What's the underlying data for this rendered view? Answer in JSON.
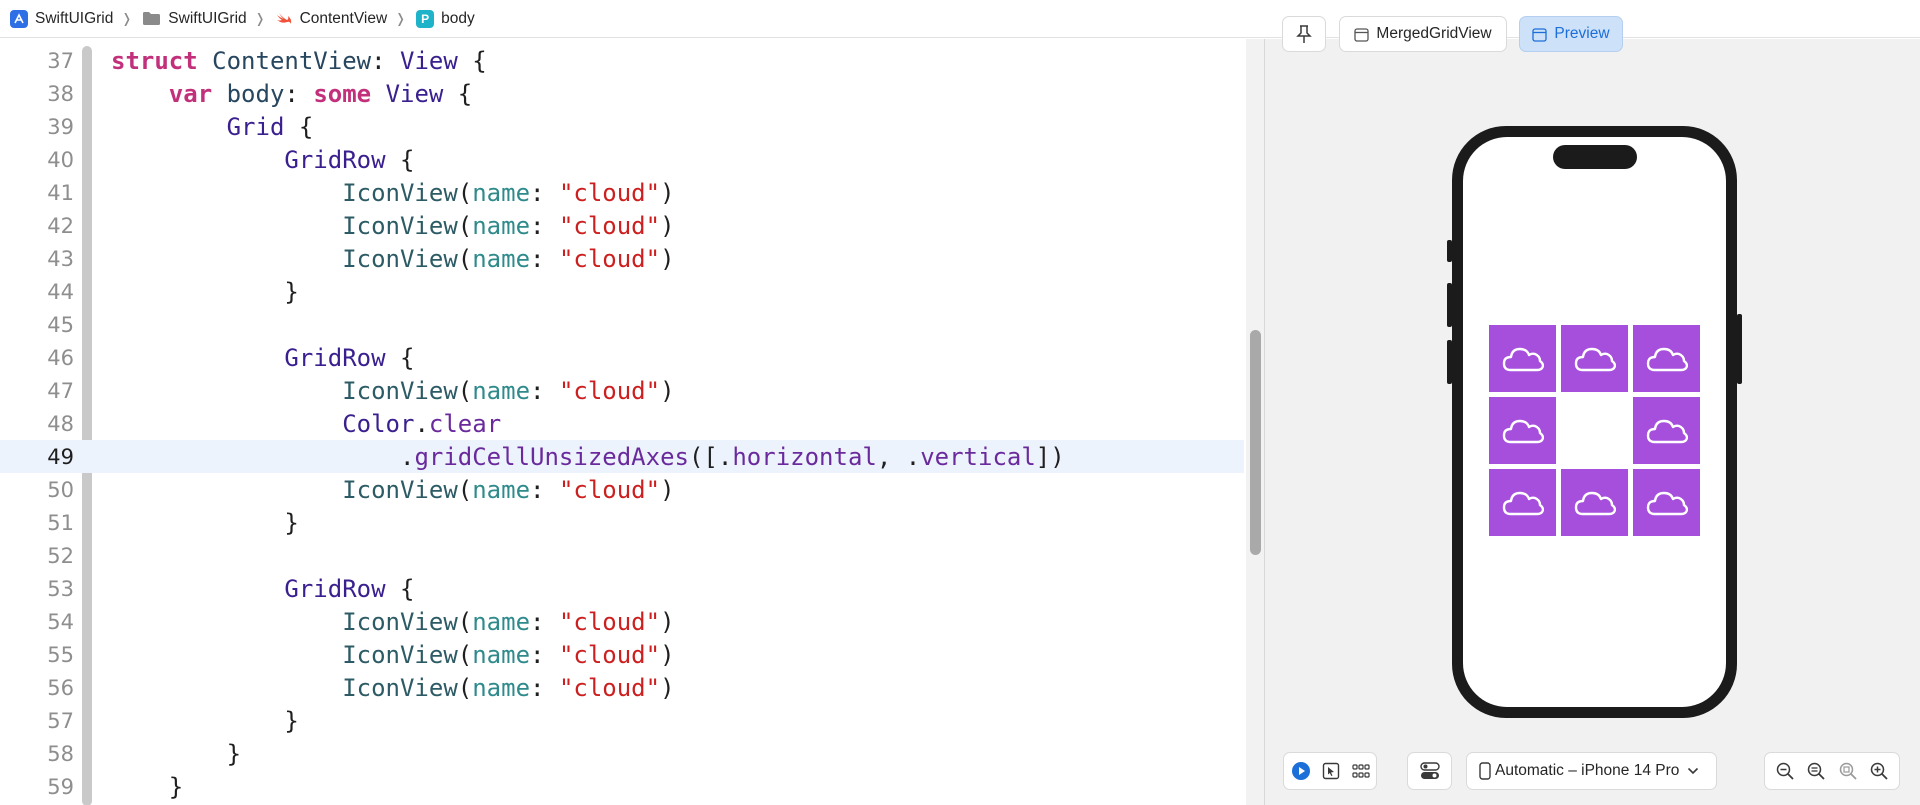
{
  "breadcrumb": {
    "project": "SwiftUIGrid",
    "group": "SwiftUIGrid",
    "file": "ContentView",
    "symbol": "body",
    "symbol_badge": "P"
  },
  "editor": {
    "current_line": "49",
    "lines": [
      {
        "n": "37"
      },
      {
        "n": "38"
      },
      {
        "n": "39"
      },
      {
        "n": "40"
      },
      {
        "n": "41"
      },
      {
        "n": "42"
      },
      {
        "n": "43"
      },
      {
        "n": "44"
      },
      {
        "n": "45"
      },
      {
        "n": "46"
      },
      {
        "n": "47"
      },
      {
        "n": "48"
      },
      {
        "n": "49"
      },
      {
        "n": "50"
      },
      {
        "n": "51"
      },
      {
        "n": "52"
      },
      {
        "n": "53"
      },
      {
        "n": "54"
      },
      {
        "n": "55"
      },
      {
        "n": "56"
      },
      {
        "n": "57"
      },
      {
        "n": "58"
      },
      {
        "n": "59"
      }
    ],
    "code": {
      "l37": [
        "struct",
        " ",
        "ContentView",
        ": ",
        "View",
        " {"
      ],
      "l38": [
        "var",
        " ",
        "body",
        ": ",
        "some",
        " ",
        "View",
        " {"
      ],
      "l39": [
        "Grid",
        " {"
      ],
      "gridrow": "GridRow",
      "brace_open": " {",
      "brace_close": "}",
      "iconview": "IconView",
      "paren_open": "(",
      "param": "name",
      "colon": ": ",
      "cloud": "\"cloud\"",
      "paren_close": ")",
      "color": "Color",
      "dot": ".",
      "clear": "clear",
      "modifier": "gridCellUnsizedAxes",
      "arr_open": "([.",
      "horizontal": "horizontal",
      "comma": ", .",
      "vertical": "vertical",
      "arr_close": "])"
    }
  },
  "preview": {
    "pin_icon": "pin-icon",
    "merged_tab": "MergedGridView",
    "preview_tab": "Preview",
    "device": "Automatic – iPhone 14 Pro",
    "grid_color": "#a64fdd",
    "grid": [
      [
        "cloud",
        "cloud",
        "cloud"
      ],
      [
        "cloud",
        "",
        "cloud"
      ],
      [
        "cloud",
        "cloud",
        "cloud"
      ]
    ]
  }
}
